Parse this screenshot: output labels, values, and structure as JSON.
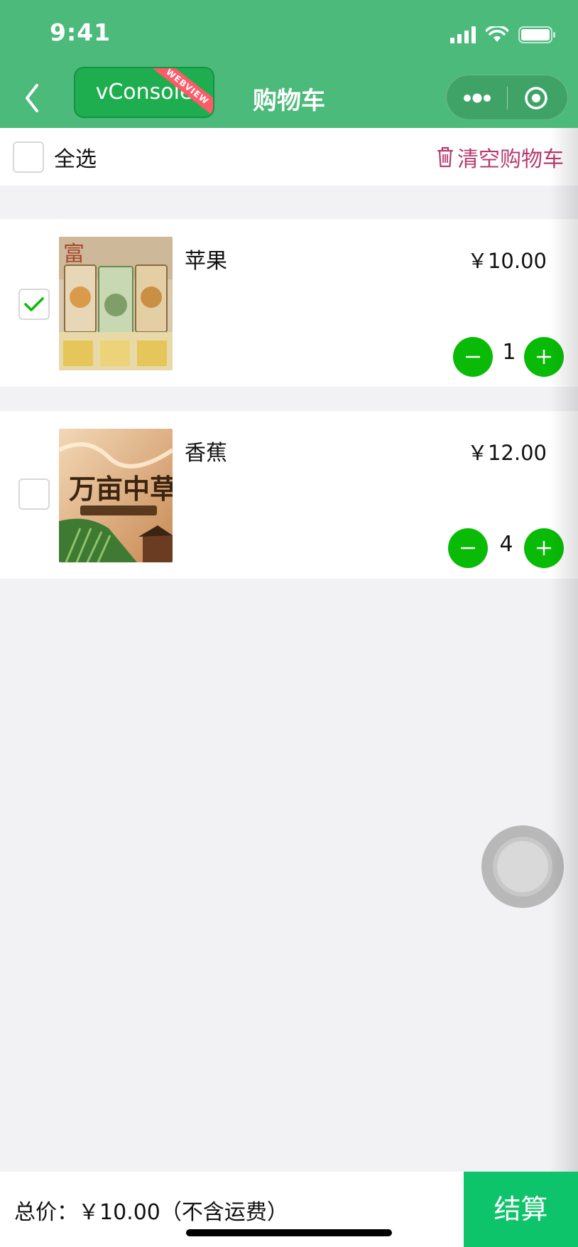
{
  "status_bar": {
    "time": "9:41"
  },
  "nav": {
    "vconsole_label": "vConsole",
    "vconsole_ribbon": "WEBVIEW",
    "title": "购物车",
    "back_icon": "chevron-left-icon",
    "menu_icon": "more-dots-icon",
    "close_icon": "target-circle-icon"
  },
  "select_bar": {
    "select_all_label": "全选",
    "clear_label": "清空购物车",
    "clear_icon": "trash-icon"
  },
  "items": [
    {
      "name": "苹果",
      "price": "￥10.00",
      "quantity": "1",
      "checked": true
    },
    {
      "name": "香蕉",
      "price": "￥12.00",
      "quantity": "4",
      "checked": false
    }
  ],
  "footer": {
    "total_text": "总价：￥10.00（不含运费）",
    "checkout_label": "结算"
  },
  "colors": {
    "nav_green": "#4cba7a",
    "button_green": "#09bb07",
    "checkout_green": "#0ec46a",
    "clear_pink": "#b63b70"
  }
}
